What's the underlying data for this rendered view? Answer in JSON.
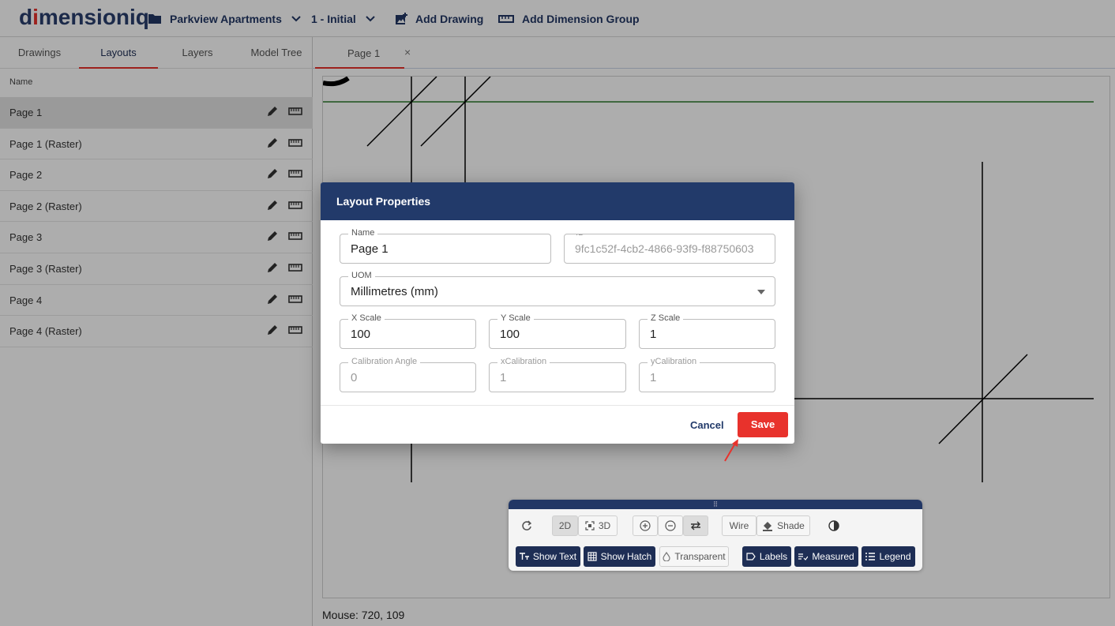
{
  "header": {
    "logo_main_a": "d",
    "logo_red": "i",
    "logo_main_b": "mensioniq",
    "project": "Parkview Apartments",
    "revision": "1 - Initial",
    "add_drawing": "Add Drawing",
    "add_dimension_group": "Add Dimension Group"
  },
  "left": {
    "tabs": [
      "Drawings",
      "Layouts",
      "Layers",
      "Model Tree"
    ],
    "active_tab": "Layouts",
    "column_name": "Name",
    "items": [
      {
        "label": "Page 1"
      },
      {
        "label": "Page 1 (Raster)"
      },
      {
        "label": "Page 2"
      },
      {
        "label": "Page 2 (Raster)"
      },
      {
        "label": "Page 3"
      },
      {
        "label": "Page 3 (Raster)"
      },
      {
        "label": "Page 4"
      },
      {
        "label": "Page 4 (Raster)"
      }
    ]
  },
  "right": {
    "tab_label": "Page 1",
    "tab_close": "×",
    "mouse": "Mouse: 720, 109"
  },
  "toolbar": {
    "grip": "⠿",
    "btn_2d": "2D",
    "btn_3d": "3D",
    "wire": "Wire",
    "shade": "Shade",
    "show_text": "Show Text",
    "show_hatch": "Show Hatch",
    "transparent": "Transparent",
    "labels": "Labels",
    "measured": "Measured",
    "legend": "Legend"
  },
  "dialog": {
    "title": "Layout Properties",
    "name_label": "Name",
    "name_value": "Page 1",
    "id_label": "ID",
    "id_value": "9fc1c52f-4cb2-4866-93f9-f88750603",
    "uom_label": "UOM",
    "uom_value": "Millimetres (mm)",
    "xscale_label": "X Scale",
    "xscale_value": "100",
    "yscale_label": "Y Scale",
    "yscale_value": "100",
    "zscale_label": "Z Scale",
    "zscale_value": "1",
    "calangle_label": "Calibration Angle",
    "calangle_value": "0",
    "xcal_label": "xCalibration",
    "xcal_value": "1",
    "ycal_label": "yCalibration",
    "ycal_value": "1",
    "cancel": "Cancel",
    "save": "Save"
  },
  "colors": {
    "navy": "#223a6a",
    "accent_red": "#e8322c"
  }
}
